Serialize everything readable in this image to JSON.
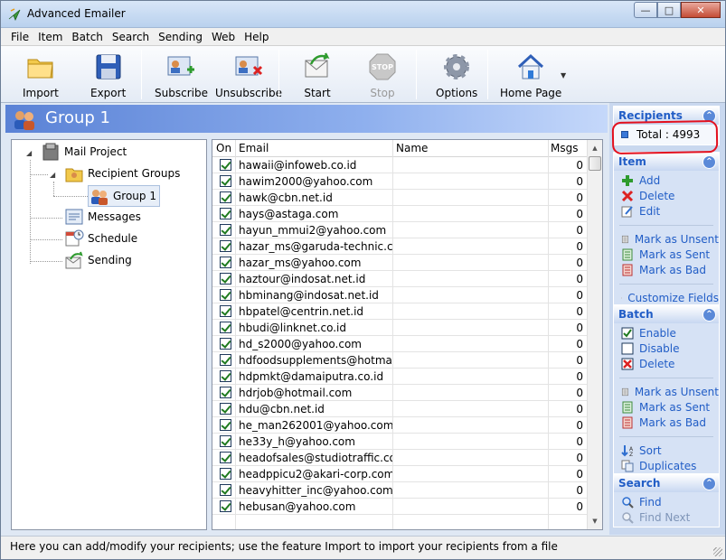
{
  "window": {
    "title": "Advanced Emailer"
  },
  "menu": [
    "File",
    "Item",
    "Batch",
    "Search",
    "Sending",
    "Web",
    "Help"
  ],
  "toolbar": {
    "import": "Import",
    "export": "Export",
    "subscribe": "Subscribe",
    "unsubscribe": "Unsubscribe",
    "start": "Start",
    "stop": "Stop",
    "options": "Options",
    "home_page": "Home Page"
  },
  "header": {
    "title": "Group 1"
  },
  "tree": {
    "mail_project": "Mail Project",
    "recipient_groups": "Recipient Groups",
    "group1": "Group 1",
    "messages": "Messages",
    "schedule": "Schedule",
    "sending": "Sending"
  },
  "grid": {
    "columns": {
      "on": "On",
      "email": "Email",
      "name": "Name",
      "msgs": "Msgs"
    },
    "rows": [
      {
        "email": "hawaii@infoweb.co.id",
        "msgs": "0"
      },
      {
        "email": "hawim2000@yahoo.com",
        "msgs": "0"
      },
      {
        "email": "hawk@cbn.net.id",
        "msgs": "0"
      },
      {
        "email": "hays@astaga.com",
        "msgs": "0"
      },
      {
        "email": "hayun_mmui2@yahoo.com",
        "msgs": "0"
      },
      {
        "email": "hazar_ms@garuda-technic.co.id",
        "msgs": "0"
      },
      {
        "email": "hazar_ms@yahoo.com",
        "msgs": "0"
      },
      {
        "email": "haztour@indosat.net.id",
        "msgs": "0"
      },
      {
        "email": "hbminang@indosat.net.id",
        "msgs": "0"
      },
      {
        "email": "hbpatel@centrin.net.id",
        "msgs": "0"
      },
      {
        "email": "hbudi@linknet.co.id",
        "msgs": "0"
      },
      {
        "email": "hd_s2000@yahoo.com",
        "msgs": "0"
      },
      {
        "email": "hdfoodsupplements@hotmail.com",
        "msgs": "0"
      },
      {
        "email": "hdpmkt@damaiputra.co.id",
        "msgs": "0"
      },
      {
        "email": "hdrjob@hotmail.com",
        "msgs": "0"
      },
      {
        "email": "hdu@cbn.net.id",
        "msgs": "0"
      },
      {
        "email": "he_man262001@yahoo.com",
        "msgs": "0"
      },
      {
        "email": "he33y_h@yahoo.com",
        "msgs": "0"
      },
      {
        "email": "headofsales@studiotraffic.com",
        "msgs": "0"
      },
      {
        "email": "headppicu2@akari-corp.com",
        "msgs": "0"
      },
      {
        "email": "heavyhitter_inc@yahoo.com",
        "msgs": "0"
      },
      {
        "email": "hebusan@yahoo.com",
        "msgs": "0"
      }
    ]
  },
  "panels": {
    "recipients": {
      "title": "Recipients",
      "total": "Total : 4993"
    },
    "item": {
      "title": "Item",
      "add": "Add",
      "delete": "Delete",
      "edit": "Edit",
      "mark_unsent": "Mark as Unsent",
      "mark_sent": "Mark as Sent",
      "mark_bad": "Mark as Bad",
      "customize": "Customize Fields"
    },
    "batch": {
      "title": "Batch",
      "enable": "Enable",
      "disable": "Disable",
      "delete": "Delete",
      "mark_unsent": "Mark as Unsent",
      "mark_sent": "Mark as Sent",
      "mark_bad": "Mark as Bad",
      "sort": "Sort",
      "duplicates": "Duplicates"
    },
    "search": {
      "title": "Search",
      "find": "Find",
      "find_next": "Find Next"
    }
  },
  "statusbar": {
    "text": "Here you can add/modify your recipients; use the feature Import to import your recipients from a file"
  },
  "colors": {
    "accent": "#215dc6",
    "header_start": "#5a82d6",
    "annotation": "#e3101e"
  }
}
